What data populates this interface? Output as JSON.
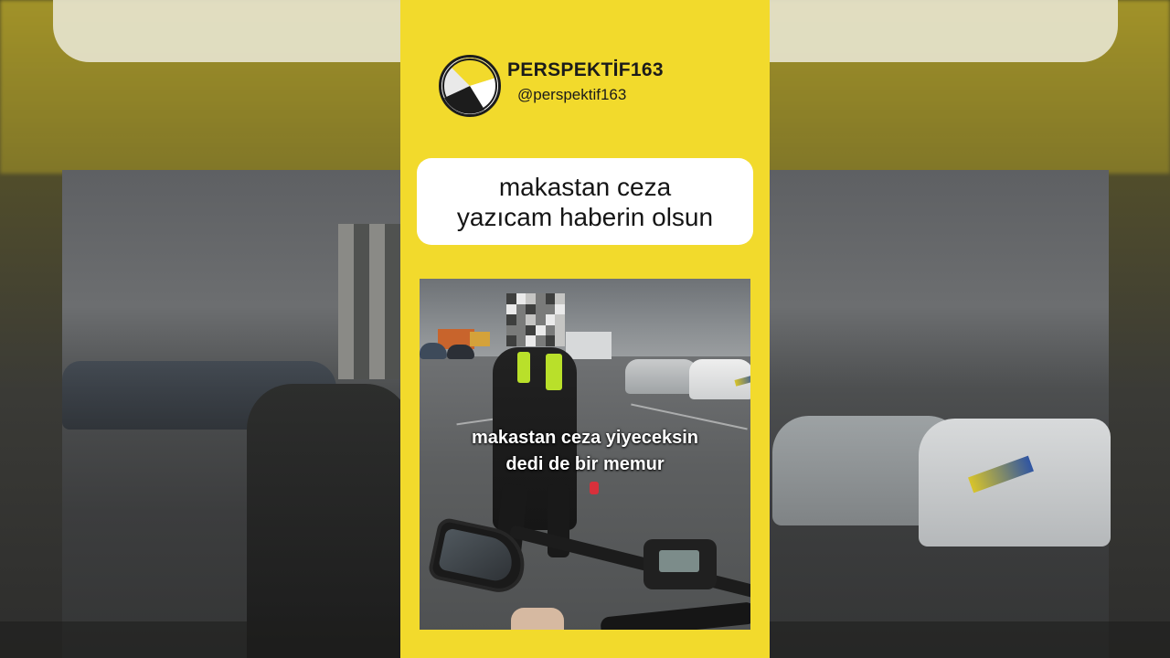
{
  "channel": {
    "name": "PERSPEKTİF163",
    "handle": "@perspektif163"
  },
  "caption": {
    "line1": "makastan ceza",
    "line2": "yazıcam haberin olsun"
  },
  "video_subtitle": {
    "line1": "makastan ceza yiyeceksin",
    "line2": "dedi de bir memur"
  },
  "colors": {
    "accent_yellow": "#f2da2c",
    "caption_background": "#ffffff",
    "vest_hi_vis": "#b9e02a"
  },
  "icons": {
    "logo": "perspektif-lens-logo-icon"
  }
}
